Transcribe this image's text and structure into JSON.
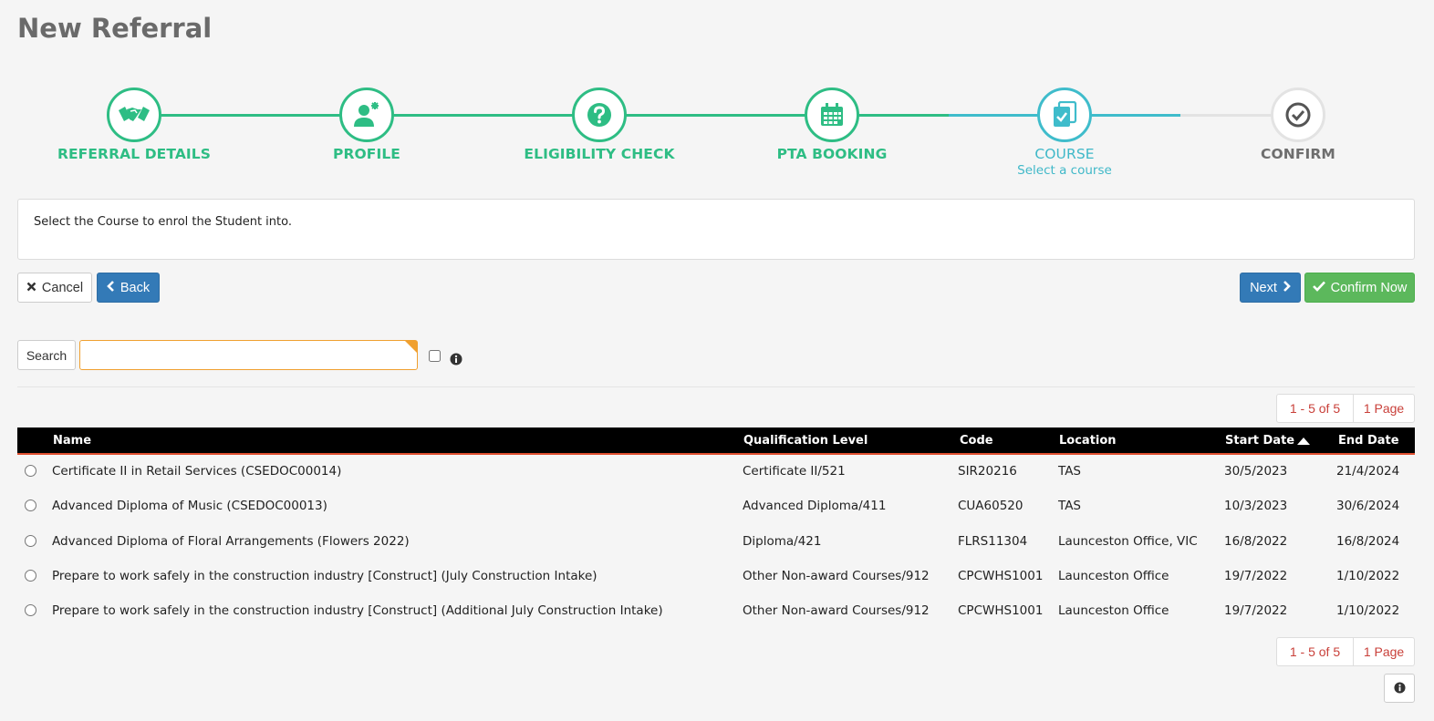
{
  "page": {
    "title": "New Referral"
  },
  "colors": {
    "complete": "#2ebd84",
    "active": "#3fbccb",
    "pending": "#e3e3e3",
    "primary": "#337ab7",
    "success": "#5cb85c",
    "pager_text": "#c9403a"
  },
  "wizard": {
    "steps": [
      {
        "label": "REFERRAL DETAILS",
        "icon": "handshake-icon",
        "state": "complete"
      },
      {
        "label": "PROFILE",
        "icon": "user-plus-icon",
        "state": "complete"
      },
      {
        "label": "ELIGIBILITY CHECK",
        "icon": "question-icon",
        "state": "complete"
      },
      {
        "label": "PTA BOOKING",
        "icon": "calendar-icon",
        "state": "complete"
      },
      {
        "label": "COURSE",
        "sublabel": "Select a course",
        "icon": "course-copy-icon",
        "state": "active"
      },
      {
        "label": "CONFIRM",
        "icon": "check-circle-icon",
        "state": "pending"
      }
    ]
  },
  "info": {
    "text": "Select the Course to enrol the Student into."
  },
  "actions": {
    "cancel": "Cancel",
    "back": "Back",
    "next": "Next",
    "confirm": "Confirm Now"
  },
  "search": {
    "button": "Search",
    "value": "",
    "placeholder": ""
  },
  "pager": {
    "range": "1 - 5 of 5",
    "pages": "1 Page"
  },
  "grid": {
    "columns": {
      "name": "Name",
      "qualification": "Qualification Level",
      "code": "Code",
      "location": "Location",
      "start": "Start Date",
      "end": "End Date"
    },
    "sort": {
      "column": "Start Date",
      "direction": "ascending"
    },
    "rows": [
      {
        "name": "Certificate II in Retail Services (CSEDOC00014)",
        "qualification": "Certificate II/521",
        "code": "SIR20216",
        "location": "TAS",
        "start": "30/5/2023",
        "end": "21/4/2024"
      },
      {
        "name": "Advanced Diploma of Music (CSEDOC00013)",
        "qualification": "Advanced Diploma/411",
        "code": "CUA60520",
        "location": "TAS",
        "start": "10/3/2023",
        "end": "30/6/2024"
      },
      {
        "name": "Advanced Diploma of Floral Arrangements (Flowers 2022)",
        "qualification": "Diploma/421",
        "code": "FLRS11304",
        "location": "Launceston Office, VIC",
        "start": "16/8/2022",
        "end": "16/8/2024"
      },
      {
        "name": "Prepare to work safely in the construction industry [Construct] (July Construction Intake)",
        "qualification": "Other Non-award Courses/912",
        "code": "CPCWHS1001",
        "location": "Launceston Office",
        "start": "19/7/2022",
        "end": "1/10/2022"
      },
      {
        "name": "Prepare to work safely in the construction industry [Construct] (Additional July Construction Intake)",
        "qualification": "Other Non-award Courses/912",
        "code": "CPCWHS1001",
        "location": "Launceston Office",
        "start": "19/7/2022",
        "end": "1/10/2022"
      }
    ]
  }
}
